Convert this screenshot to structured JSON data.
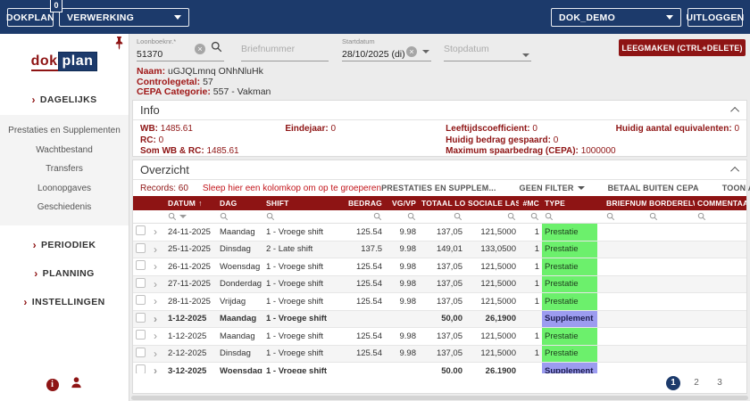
{
  "colors": {
    "navy": "#1c3a6b",
    "maroon": "#8e1414",
    "prestatie_green": "#6cf06c",
    "supplement_purple": "#9c9cf0"
  },
  "topbar": {
    "brand": "DOKPLAN",
    "badge": "0",
    "module": "VERWERKING",
    "environment": "DOK_DEMO",
    "logout": "UITLOGGEN"
  },
  "sidebar": {
    "logo_dok": "dok",
    "logo_plan": "plan",
    "menu": {
      "dagelijks": "DAGELIJKS",
      "dagelijks_items": [
        "Prestaties en Supplementen",
        "Wachtbestand",
        "Transfers",
        "Loonopgaves",
        "Geschiedenis"
      ],
      "periodiek": "PERIODIEK",
      "planning": "PLANNING",
      "instellingen": "INSTELLINGEN"
    }
  },
  "filters": {
    "loonboeknr_label": "Loonboeknr.*",
    "loonboeknr_value": "51370",
    "briefnummer_placeholder": "Briefnummer",
    "startdatum_label": "Startdatum",
    "startdatum_value": "28/10/2025 (di)",
    "stopdatum_placeholder": "Stopdatum",
    "clear_button": "LEEGMAKEN (CTRL+DELETE)"
  },
  "person": {
    "naam_label": "Naam:",
    "naam_value": "uGJQLmnq ONhNluHk",
    "controlegetal_label": "Controlegetal:",
    "controlegetal_value": "57",
    "cepa_label": "CEPA Categorie:",
    "cepa_value": "557 - Vakman"
  },
  "info": {
    "title": "Info",
    "col1": [
      {
        "label": "WB:",
        "value": "1485.61"
      },
      {
        "label": "RC:",
        "value": "0"
      },
      {
        "label": "Som WB & RC:",
        "value": "1485.61"
      }
    ],
    "col2": [
      {
        "label": "Eindejaar:",
        "value": "0"
      }
    ],
    "col3": [
      {
        "label": "Leeftijdscoefficient:",
        "value": "0"
      },
      {
        "label": "Huidig bedrag gespaard:",
        "value": "0"
      },
      {
        "label": "Maximum spaarbedrag (CEPA):",
        "value": "1000000"
      }
    ],
    "col4": [
      {
        "label": "Huidig aantal equivalenten:",
        "value": "0"
      }
    ]
  },
  "overzicht": {
    "title": "Overzicht",
    "records": "Records: 60",
    "groupby_hint": "Sleep hier een kolomkop om op te groeperen",
    "toolbar": {
      "prestaties": "PRESTATIES EN SUPPLEM...",
      "filter": "GEEN FILTER",
      "betaal": "BETAAL BUITEN CEPA",
      "toon": "TOON ACTIEVE"
    },
    "columns": [
      "DATUM",
      "DAG",
      "SHIFT",
      "BEDRAG",
      "VG/VP",
      "TOTAAL LOON",
      "SOCIALE LAST...",
      "#MC",
      "TYPE",
      "BRIEFNUM...",
      "BORDERELWE...",
      "COMMENTAAR"
    ],
    "rows": [
      {
        "datum": "24-11-2025",
        "dag": "Maandag",
        "shift": "1 - Vroege shift",
        "bedrag": "125.54",
        "vgvp": "9.98",
        "totaal": "137,05",
        "sociale": "121,5000",
        "mc": "1",
        "type": "Prestatie",
        "type_color": "green",
        "bold": false,
        "partial": false
      },
      {
        "datum": "25-11-2025",
        "dag": "Dinsdag",
        "shift": "2 - Late shift",
        "bedrag": "137.5",
        "vgvp": "9.98",
        "totaal": "149,01",
        "sociale": "133,0500",
        "mc": "1",
        "type": "Prestatie",
        "type_color": "green",
        "bold": false,
        "partial": false
      },
      {
        "datum": "26-11-2025",
        "dag": "Woensdag",
        "shift": "1 - Vroege shift",
        "bedrag": "125.54",
        "vgvp": "9.98",
        "totaal": "137,05",
        "sociale": "121,5000",
        "mc": "1",
        "type": "Prestatie",
        "type_color": "green",
        "bold": false,
        "partial": false
      },
      {
        "datum": "27-11-2025",
        "dag": "Donderdag",
        "shift": "1 - Vroege shift",
        "bedrag": "125.54",
        "vgvp": "9.98",
        "totaal": "137,05",
        "sociale": "121,5000",
        "mc": "1",
        "type": "Prestatie",
        "type_color": "green",
        "bold": false,
        "partial": false
      },
      {
        "datum": "28-11-2025",
        "dag": "Vrijdag",
        "shift": "1 - Vroege shift",
        "bedrag": "125.54",
        "vgvp": "9.98",
        "totaal": "137,05",
        "sociale": "121,5000",
        "mc": "1",
        "type": "Prestatie",
        "type_color": "green",
        "bold": false,
        "partial": false
      },
      {
        "datum": "1-12-2025",
        "dag": "Maandag",
        "shift": "1 - Vroege shift",
        "bedrag": "",
        "vgvp": "",
        "totaal": "50,00",
        "sociale": "26,1900",
        "mc": "",
        "type": "Supplement",
        "type_color": "purple",
        "bold": true,
        "partial": false
      },
      {
        "datum": "1-12-2025",
        "dag": "Maandag",
        "shift": "1 - Vroege shift",
        "bedrag": "125.54",
        "vgvp": "9.98",
        "totaal": "137,05",
        "sociale": "121,5000",
        "mc": "1",
        "type": "Prestatie",
        "type_color": "green",
        "bold": false,
        "partial": false
      },
      {
        "datum": "2-12-2025",
        "dag": "Dinsdag",
        "shift": "1 - Vroege shift",
        "bedrag": "125.54",
        "vgvp": "9.98",
        "totaal": "137,05",
        "sociale": "121,5000",
        "mc": "1",
        "type": "Prestatie",
        "type_color": "green",
        "bold": false,
        "partial": false
      },
      {
        "datum": "3-12-2025",
        "dag": "Woensdag",
        "shift": "1 - Vroege shift",
        "bedrag": "",
        "vgvp": "",
        "totaal": "50,00",
        "sociale": "26,1900",
        "mc": "",
        "type": "Supplement",
        "type_color": "purple",
        "bold": true,
        "partial": false
      },
      {
        "datum": "",
        "dag": "",
        "shift": "",
        "bedrag": "",
        "vgvp": "",
        "totaal": "",
        "sociale": "",
        "mc": "",
        "type": "",
        "type_color": "green",
        "bold": false,
        "partial": true
      }
    ],
    "pagination": [
      "1",
      "2",
      "3"
    ]
  }
}
